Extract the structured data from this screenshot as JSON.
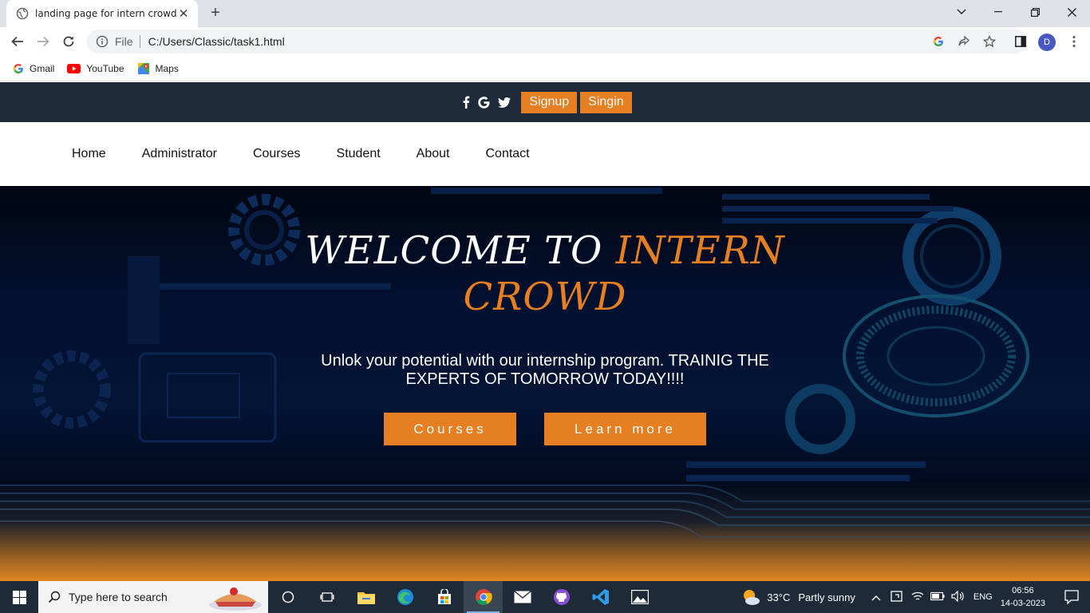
{
  "browser": {
    "tab_title": "landing page for intern crowd",
    "address_prefix": "File",
    "url": "C:/Users/Classic/task1.html",
    "profile_initial": "D",
    "bookmarks": [
      "Gmail",
      "YouTube",
      "Maps"
    ]
  },
  "page": {
    "auth": {
      "signup": "Signup",
      "signin": "Singin"
    },
    "nav": [
      "Home",
      "Administrator",
      "Courses",
      "Student",
      "About",
      "Contact"
    ],
    "hero": {
      "title_white": "WELCOME TO ",
      "title_accent_1": "INTERN",
      "title_accent_2": "CROWD",
      "subtitle": "Unlok your potential with our internship program. TRAINIG THE EXPERTS OF TOMORROW TODAY!!!!",
      "btn_courses": "Courses",
      "btn_learn": "Learn more"
    },
    "colors": {
      "accent": "#e67e22",
      "topbar": "#1d2a3a"
    }
  },
  "taskbar": {
    "search_placeholder": "Type here to search",
    "weather_temp": "33°C",
    "weather_desc": "Partly sunny",
    "language": "ENG",
    "time": "06:56",
    "date": "14-03-2023"
  }
}
